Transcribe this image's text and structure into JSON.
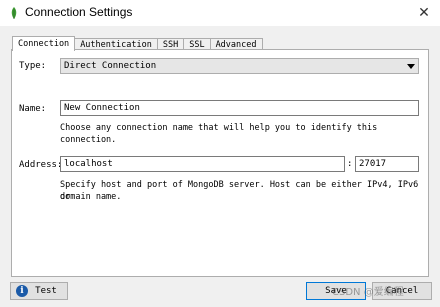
{
  "window": {
    "title": "Connection Settings"
  },
  "tabs": [
    "Connection",
    "Authentication",
    "SSH",
    "SSL",
    "Advanced"
  ],
  "connection": {
    "type_label": "Type:",
    "type_value": "Direct Connection",
    "name_label": "Name:",
    "name_value": "New Connection",
    "name_hint": "Choose any connection name that will help you to identify this connection.",
    "address_label": "Address:",
    "host_value": "localhost",
    "port_separator": ":",
    "port_value": "27017",
    "address_hint_line1": "Specify host and port of MongoDB server. Host can be either IPv4, IPv6 or",
    "address_hint_line2": "domain name."
  },
  "footer": {
    "test_label": "Test",
    "save_label": "Save",
    "cancel_label": "Cancel",
    "watermark": "CSDN @爱编程"
  },
  "icons": {
    "app": "mongodb-leaf-icon",
    "close": "close-icon",
    "info": "info-icon",
    "dropdown": "chevron-down-icon"
  }
}
